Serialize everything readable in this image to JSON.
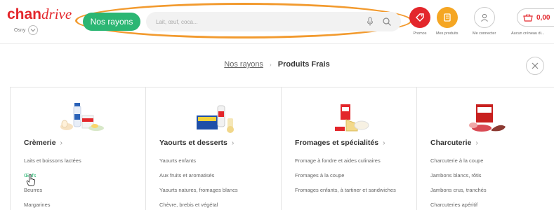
{
  "header": {
    "logo_part1": "chan",
    "logo_part2": "drive",
    "store_name": "Osny",
    "rayons_button": "Nos rayons",
    "search_placeholder": "Lait, œuf, coca...",
    "promos_label": "Promos",
    "products_label": "Mes produits",
    "account_label": "Me connecter",
    "cart_amount": "0,00",
    "delivery_label": "Aucun créneau di..."
  },
  "breadcrumb": {
    "root": "Nos rayons",
    "current": "Produits Frais"
  },
  "categories": [
    {
      "title": "Crèmerie",
      "items": [
        "Laits et boissons lactées",
        "Œufs",
        "Beurres",
        "Margarines"
      ]
    },
    {
      "title": "Yaourts et desserts",
      "items": [
        "Yaourts enfants",
        "Aux fruits et aromatisés",
        "Yaourts natures, fromages blancs",
        "Chèvre, brebis et végétal"
      ]
    },
    {
      "title": "Fromages et spécialités",
      "items": [
        "Fromage à fondre et aides culinaires",
        "Fromages à la coupe",
        "Fromages enfants, à tartiner et sandwiches",
        ""
      ]
    },
    {
      "title": "Charcuterie",
      "items": [
        "Charcuterie à la coupe",
        "Jambons blancs, rôtis",
        "Jambons crus, tranchés",
        "Charcuteries apéritif"
      ]
    }
  ],
  "colors": {
    "brand_red": "#e3262b",
    "rayons_green": "#2bb673",
    "products_orange": "#f5a623",
    "highlight_ellipse": "#f29a2e"
  }
}
